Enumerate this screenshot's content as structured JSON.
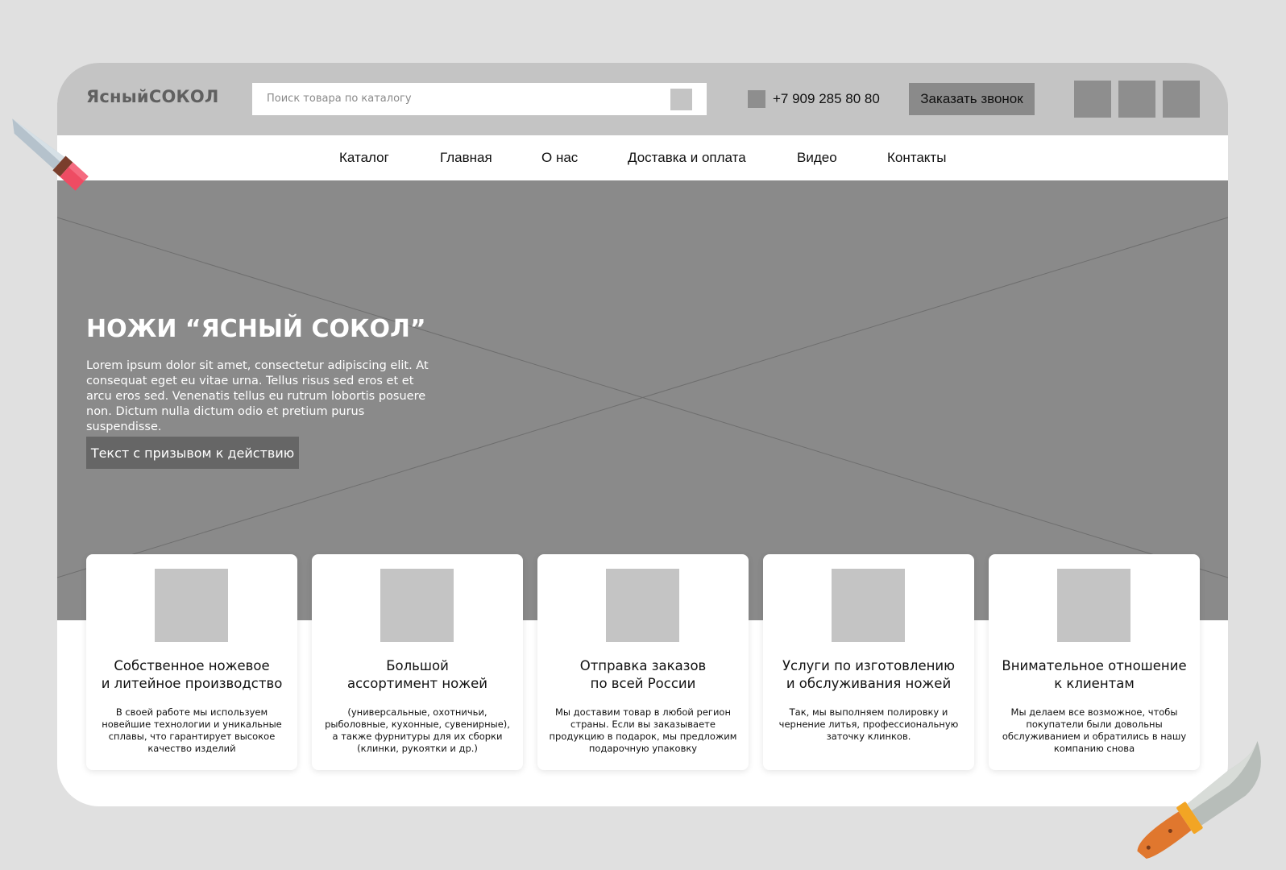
{
  "header": {
    "logo": "ЯсныйСОКОЛ",
    "search_placeholder": "Поиск товара по каталогу",
    "phone": "+7 909 285 80 80",
    "callback_label": "Заказать звонок"
  },
  "nav": {
    "items": [
      "Каталог",
      "Главная",
      "О нас",
      "Доставка и оплата",
      "Видео",
      "Контакты"
    ]
  },
  "hero": {
    "title": "НОЖИ “ЯСНЫЙ СОКОЛ”",
    "text": "Lorem ipsum dolor sit amet, consectetur adipiscing elit. At consequat eget eu vitae urna. Tellus risus sed eros et et arcu eros sed. Venenatis tellus eu rutrum lobortis posuere non. Dictum nulla dictum odio et pretium purus suspendisse.",
    "cta_label": "Текст с призывом к действию"
  },
  "features": [
    {
      "title": "Собственное ножевое\nи литейное производство",
      "text": "В своей работе мы используем новейшие технологии и уникальные сплавы, что гарантирует высокое качество изделий"
    },
    {
      "title": "Большой\nассортимент ножей",
      "text": "(универсальные, охотничьи, рыболовные, кухонные, сувенирные), а также фурнитуры для их сборки (клинки, рукоятки и др.)"
    },
    {
      "title": "Отправка заказов\nпо всей России",
      "text": "Мы доставим товар в любой регион страны. Если вы заказываете продукцию в подарок, мы предложим подарочную упаковку"
    },
    {
      "title": "Услуги по изготовлению\nи обслуживания ножей",
      "text": "Так, мы выполняем полировку и чернение литья, профессиональную заточку клинков."
    },
    {
      "title": "Внимательное отношение\nк клиентам",
      "text": "Мы делаем все возможное, чтобы покупатели были довольны обслуживанием и обратились в нашу компанию снова"
    }
  ],
  "colors": {
    "header_bg": "#c4c4c4",
    "hero_bg": "#8a8a8a",
    "cta_bg": "#666666",
    "page_bg": "#e0e0e0"
  }
}
